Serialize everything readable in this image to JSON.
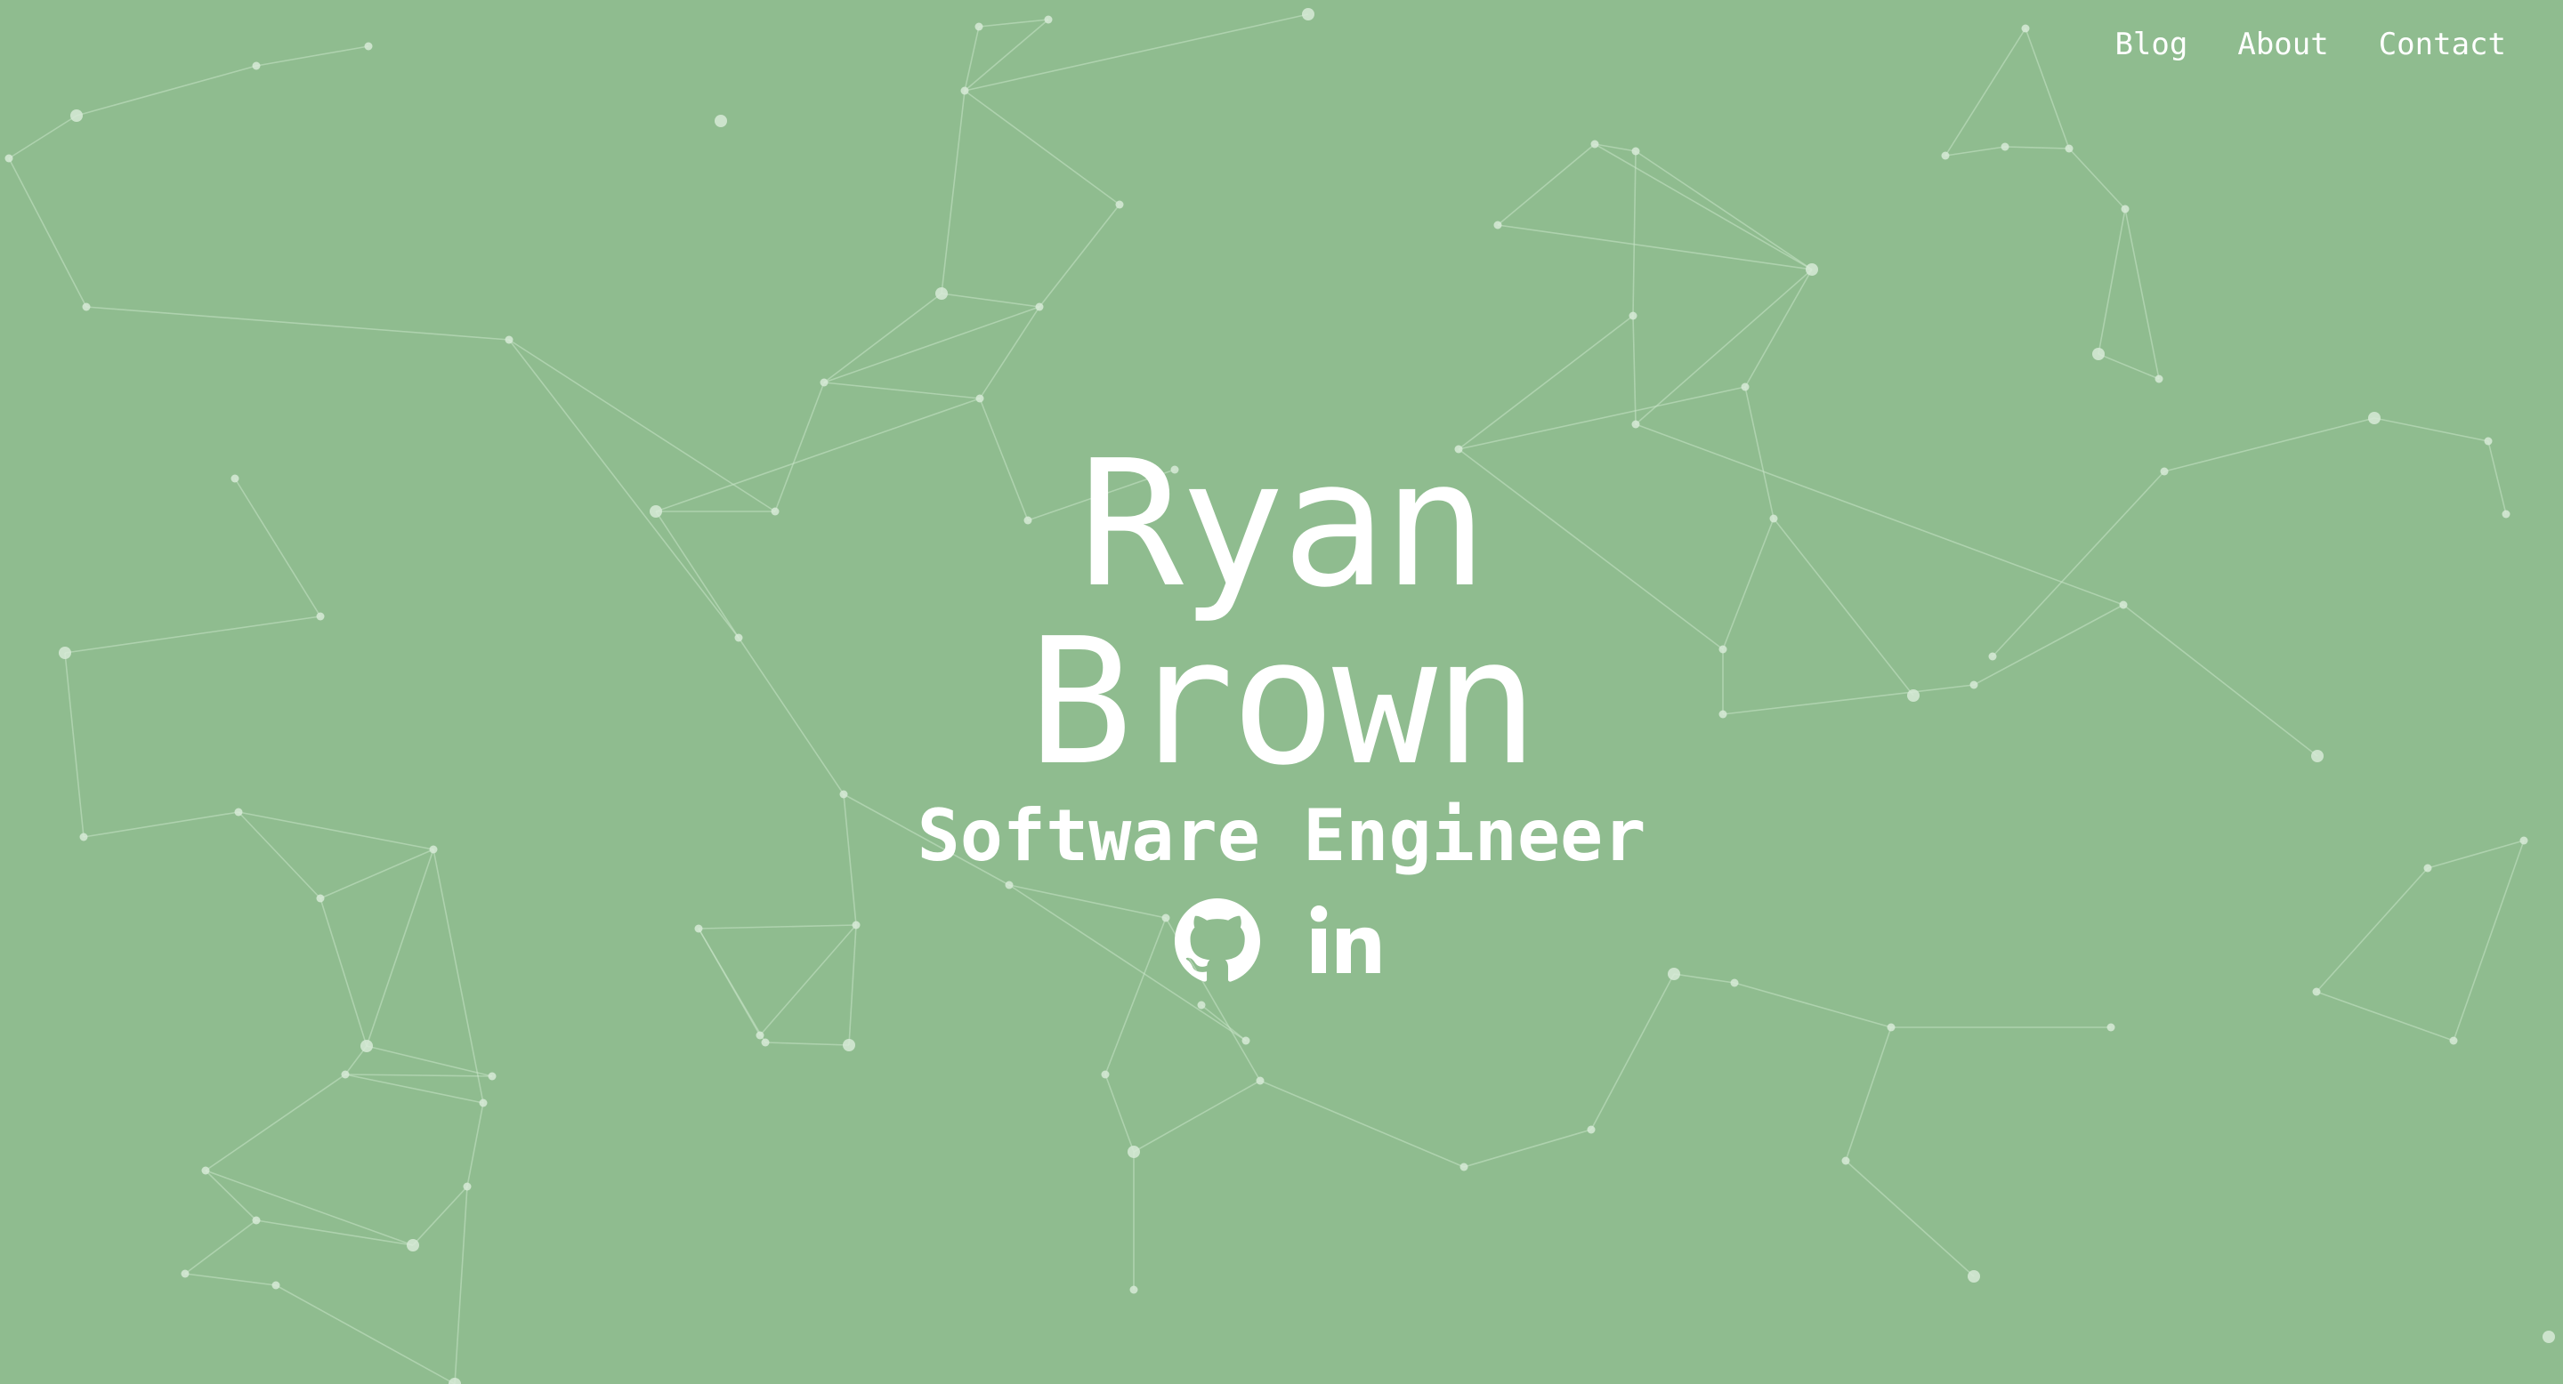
{
  "nav": {
    "items": [
      "Blog",
      "About",
      "Contact"
    ]
  },
  "hero": {
    "first_name": "Ryan",
    "last_name": "Brown",
    "title": "Software Engineer"
  },
  "socials": [
    {
      "icon": "github-icon"
    },
    {
      "icon": "linkedin-icon"
    }
  ],
  "colors": {
    "background": "#8fbc8f",
    "foreground": "#ffffff",
    "network_line": "#c8e3c8",
    "network_node": "#d7ead7"
  }
}
